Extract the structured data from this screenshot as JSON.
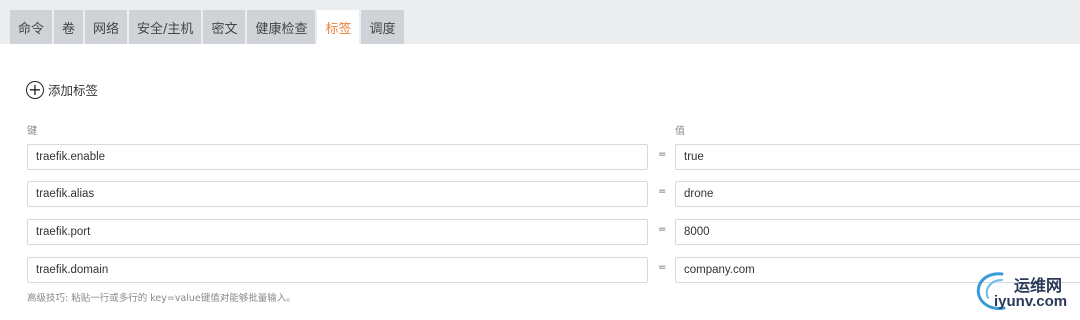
{
  "tabs": [
    {
      "label": "命令"
    },
    {
      "label": "卷"
    },
    {
      "label": "网络"
    },
    {
      "label": "安全/主机"
    },
    {
      "label": "密文"
    },
    {
      "label": "健康检查"
    },
    {
      "label": "标签",
      "active": true
    },
    {
      "label": "调度"
    }
  ],
  "add_tag": {
    "label": "添加标签",
    "icon": "plus-circle-icon"
  },
  "columns": {
    "key_label": "键",
    "value_label": "值"
  },
  "labels": [
    {
      "key": "traefik.enable",
      "value": "true"
    },
    {
      "key": "traefik.alias",
      "value": "drone"
    },
    {
      "key": "traefik.port",
      "value": "8000"
    },
    {
      "key": "traefik.domain",
      "value": "company.com"
    }
  ],
  "separator": "=",
  "hint": "高级技巧: 粘贴一行或多行的 key=value键值对能够批量输入。",
  "watermark": {
    "cn": "运维网",
    "en": "iyunv.com"
  },
  "colors": {
    "active_tab": "#e8843a",
    "tab_bg": "#cfd3d8",
    "topbar_bg": "#ecedef"
  }
}
